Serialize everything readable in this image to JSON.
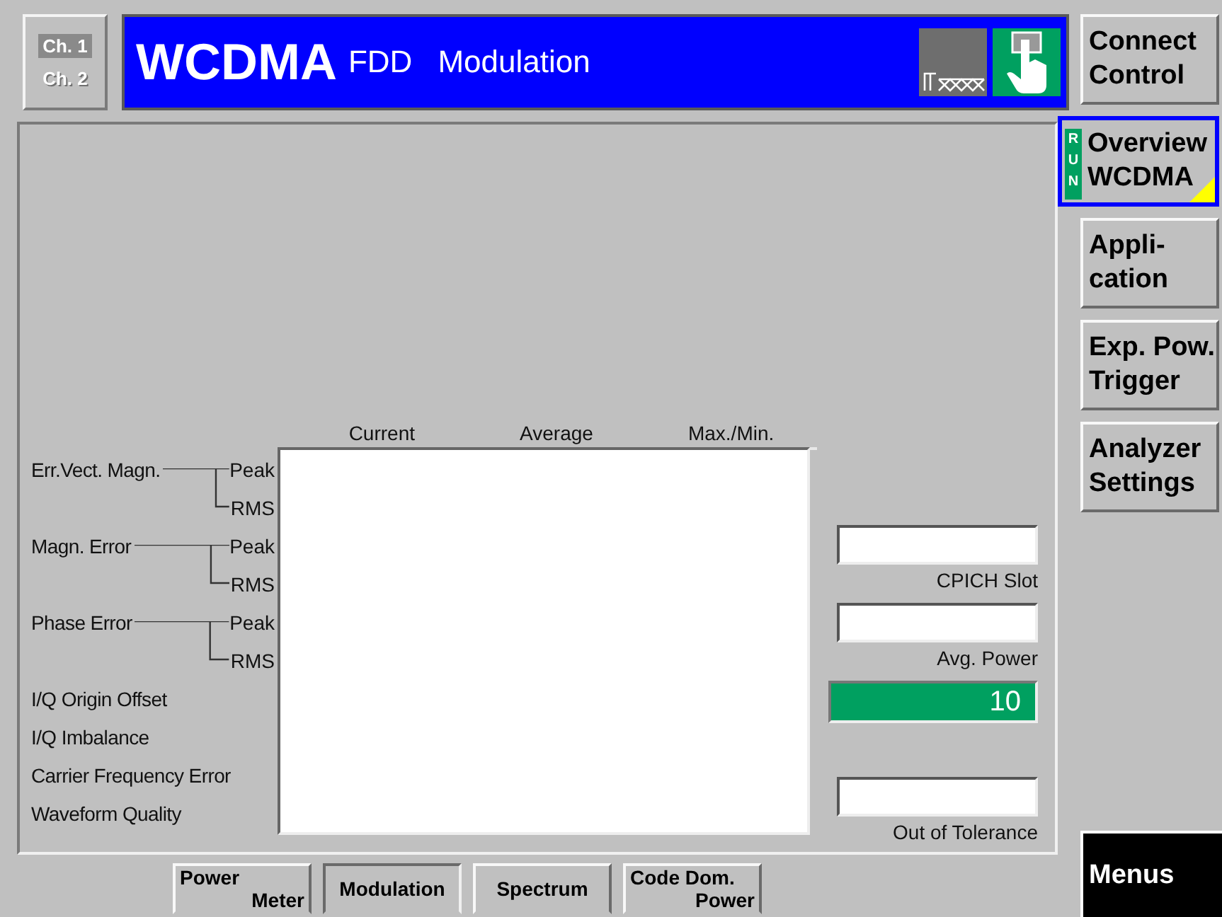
{
  "channels": [
    {
      "label": "Ch. 1",
      "selected": true
    },
    {
      "label": "Ch. 2",
      "selected": false
    }
  ],
  "header": {
    "title": "WCDMA",
    "subtitle": "FDD",
    "mode": "Modulation"
  },
  "table": {
    "columns": [
      "Current",
      "Average",
      "Max./Min."
    ],
    "rows": [
      {
        "kind": "group",
        "label": "Err.Vect. Magn.",
        "subs": [
          "Peak",
          "RMS"
        ]
      },
      {
        "kind": "group",
        "label": "Magn. Error",
        "subs": [
          "Peak",
          "RMS"
        ]
      },
      {
        "kind": "group",
        "label": "Phase Error",
        "subs": [
          "Peak",
          "RMS"
        ]
      },
      {
        "kind": "single",
        "label": "I/Q Origin Offset"
      },
      {
        "kind": "single",
        "label": "I/Q Imbalance"
      },
      {
        "kind": "single",
        "label": "Carrier Frequency Error"
      },
      {
        "kind": "single",
        "label": "Waveform Quality"
      }
    ]
  },
  "readouts": [
    {
      "kind": "field",
      "label": "CPICH Slot"
    },
    {
      "kind": "field",
      "label": "Avg. Power"
    },
    {
      "kind": "counter",
      "value": "10"
    },
    {
      "kind": "field",
      "label": "Out of Tolerance"
    }
  ],
  "softkeys": [
    {
      "lines": [
        "Connect",
        "Control"
      ],
      "selected": false
    },
    {
      "lines": [
        "Overview",
        "WCDMA"
      ],
      "selected": true,
      "run": "RUN"
    },
    {
      "lines": [
        "Appli-",
        "cation"
      ],
      "selected": false
    },
    {
      "lines": [
        "Exp. Pow.",
        "Trigger"
      ],
      "selected": false
    },
    {
      "lines": [
        "Analyzer",
        "Settings"
      ],
      "selected": false
    }
  ],
  "menus_key": "Menus",
  "bottom_tabs": [
    {
      "lines": [
        "Power",
        "Meter"
      ],
      "selected": false
    },
    {
      "lines": [
        "Modulation"
      ],
      "selected": true
    },
    {
      "lines": [
        "Spectrum"
      ],
      "selected": false
    },
    {
      "lines": [
        "Code Dom.",
        "Power"
      ],
      "selected": false
    }
  ]
}
